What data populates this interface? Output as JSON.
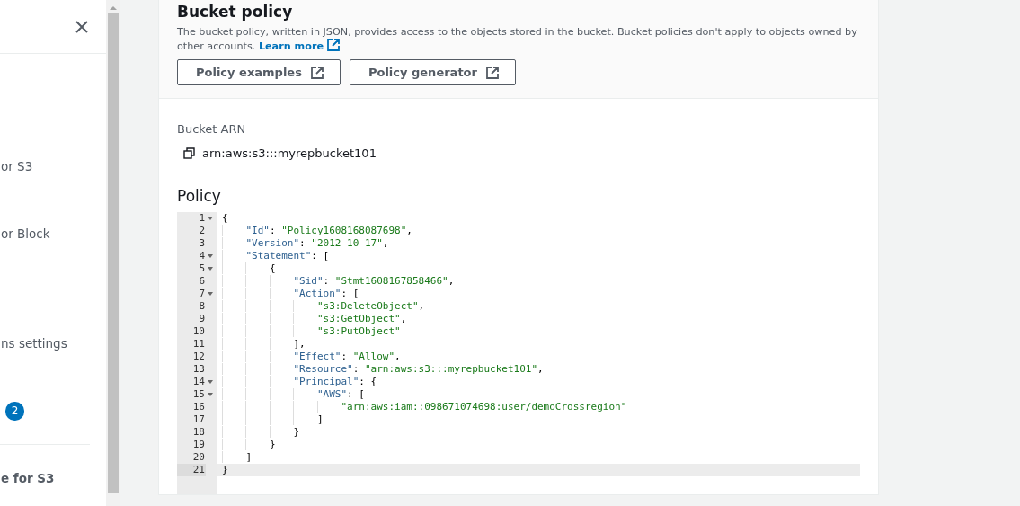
{
  "sidebar": {
    "items": [
      {
        "label": "or S3",
        "bold": false
      },
      {
        "label": "or Block",
        "bold": false
      },
      {
        "label": "ns settings",
        "bold": false
      },
      {
        "badge": "2"
      },
      {
        "label": "e for S3",
        "bold": true
      }
    ]
  },
  "panel": {
    "title": "Bucket policy",
    "description": "The bucket policy, written in JSON, provides access to the objects stored in the bucket. Bucket policies don't apply to objects owned by other accounts.",
    "learn_more": "Learn more",
    "buttons": [
      "Policy examples",
      "Policy generator"
    ]
  },
  "arn": {
    "label": "Bucket ARN",
    "value": "arn:aws:s3:::myrepbucket101"
  },
  "policy": {
    "title": "Policy",
    "lines": [
      {
        "number": "1",
        "foldable": true,
        "active": false,
        "tokens": [
          {
            "kind": "punct",
            "text": "{"
          }
        ]
      },
      {
        "number": "2",
        "foldable": false,
        "active": false,
        "tokens": [
          {
            "kind": "key",
            "text": "    \"Id\""
          },
          {
            "kind": "punct",
            "text": ": "
          },
          {
            "kind": "string",
            "text": "\"Policy1608168087698\""
          },
          {
            "kind": "punct",
            "text": ","
          }
        ]
      },
      {
        "number": "3",
        "foldable": false,
        "active": false,
        "tokens": [
          {
            "kind": "key",
            "text": "    \"Version\""
          },
          {
            "kind": "punct",
            "text": ": "
          },
          {
            "kind": "string",
            "text": "\"2012-10-17\""
          },
          {
            "kind": "punct",
            "text": ","
          }
        ]
      },
      {
        "number": "4",
        "foldable": true,
        "active": false,
        "tokens": [
          {
            "kind": "key",
            "text": "    \"Statement\""
          },
          {
            "kind": "punct",
            "text": ": ["
          }
        ]
      },
      {
        "number": "5",
        "foldable": true,
        "active": false,
        "tokens": [
          {
            "kind": "punct",
            "text": "        {"
          }
        ]
      },
      {
        "number": "6",
        "foldable": false,
        "active": false,
        "tokens": [
          {
            "kind": "key",
            "text": "            \"Sid\""
          },
          {
            "kind": "punct",
            "text": ": "
          },
          {
            "kind": "string",
            "text": "\"Stmt1608167858466\""
          },
          {
            "kind": "punct",
            "text": ","
          }
        ]
      },
      {
        "number": "7",
        "foldable": true,
        "active": false,
        "tokens": [
          {
            "kind": "key",
            "text": "            \"Action\""
          },
          {
            "kind": "punct",
            "text": ": ["
          }
        ]
      },
      {
        "number": "8",
        "foldable": false,
        "active": false,
        "tokens": [
          {
            "kind": "string",
            "text": "                \"s3:DeleteObject\""
          },
          {
            "kind": "punct",
            "text": ","
          }
        ]
      },
      {
        "number": "9",
        "foldable": false,
        "active": false,
        "tokens": [
          {
            "kind": "string",
            "text": "                \"s3:GetObject\""
          },
          {
            "kind": "punct",
            "text": ","
          }
        ]
      },
      {
        "number": "10",
        "foldable": false,
        "active": false,
        "tokens": [
          {
            "kind": "string",
            "text": "                \"s3:PutObject\""
          }
        ]
      },
      {
        "number": "11",
        "foldable": false,
        "active": false,
        "tokens": [
          {
            "kind": "punct",
            "text": "            ],"
          }
        ]
      },
      {
        "number": "12",
        "foldable": false,
        "active": false,
        "tokens": [
          {
            "kind": "key",
            "text": "            \"Effect\""
          },
          {
            "kind": "punct",
            "text": ": "
          },
          {
            "kind": "string",
            "text": "\"Allow\""
          },
          {
            "kind": "punct",
            "text": ","
          }
        ]
      },
      {
        "number": "13",
        "foldable": false,
        "active": false,
        "tokens": [
          {
            "kind": "key",
            "text": "            \"Resource\""
          },
          {
            "kind": "punct",
            "text": ": "
          },
          {
            "kind": "string",
            "text": "\"arn:aws:s3:::myrepbucket101\""
          },
          {
            "kind": "punct",
            "text": ","
          }
        ]
      },
      {
        "number": "14",
        "foldable": true,
        "active": false,
        "tokens": [
          {
            "kind": "key",
            "text": "            \"Principal\""
          },
          {
            "kind": "punct",
            "text": ": {"
          }
        ]
      },
      {
        "number": "15",
        "foldable": true,
        "active": false,
        "tokens": [
          {
            "kind": "key",
            "text": "                \"AWS\""
          },
          {
            "kind": "punct",
            "text": ": ["
          }
        ]
      },
      {
        "number": "16",
        "foldable": false,
        "active": false,
        "tokens": [
          {
            "kind": "string",
            "text": "                    \"arn:aws:iam::098671074698:user/demoCrossregion\""
          }
        ]
      },
      {
        "number": "17",
        "foldable": false,
        "active": false,
        "tokens": [
          {
            "kind": "punct",
            "text": "                ]"
          }
        ]
      },
      {
        "number": "18",
        "foldable": false,
        "active": false,
        "tokens": [
          {
            "kind": "punct",
            "text": "            }"
          }
        ]
      },
      {
        "number": "19",
        "foldable": false,
        "active": false,
        "tokens": [
          {
            "kind": "punct",
            "text": "        }"
          }
        ]
      },
      {
        "number": "20",
        "foldable": false,
        "active": false,
        "tokens": [
          {
            "kind": "punct",
            "text": "    ]"
          }
        ]
      },
      {
        "number": "21",
        "foldable": false,
        "active": true,
        "tokens": [
          {
            "kind": "punct",
            "text": "}"
          }
        ]
      }
    ]
  }
}
